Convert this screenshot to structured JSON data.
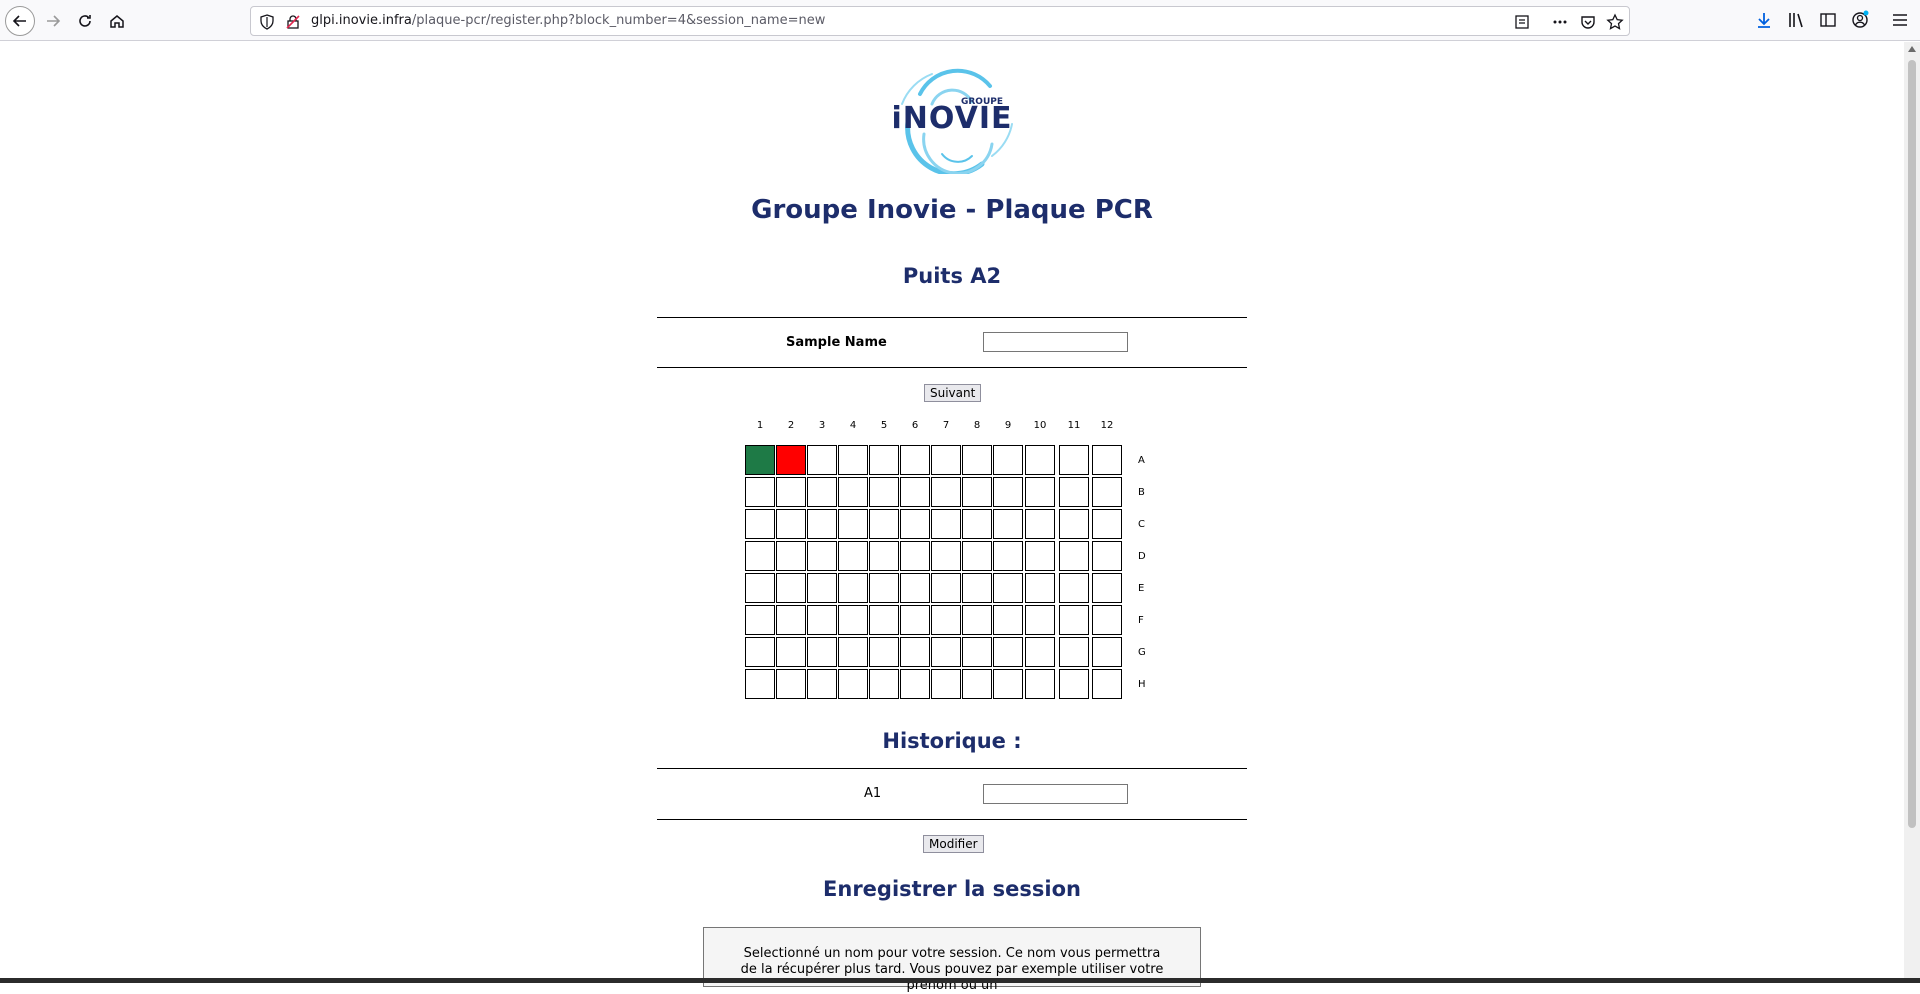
{
  "browser": {
    "url_host": "glpi.inovie.infra",
    "url_path": "/plaque-pcr/register.php?block_number=4&session_name=new"
  },
  "logo": {
    "small_text": "GROUPE",
    "brand": "iNOVIE"
  },
  "page": {
    "title": "Groupe Inovie - Plaque PCR",
    "well_heading": "Puits A2",
    "sample_label": "Sample Name",
    "sample_value": "",
    "next_button": "Suivant",
    "history_heading": "Historique :",
    "history_rows": [
      {
        "well": "A1",
        "value": ""
      }
    ],
    "modify_button": "Modifier",
    "session_heading": "Enregistrer la session",
    "session_text": "Selectionné un nom pour votre session. Ce nom vous permettra de la récupérer plus tard. Vous pouvez par exemple utiliser votre prénom ou un"
  },
  "plate": {
    "columns": [
      "1",
      "2",
      "3",
      "4",
      "5",
      "6",
      "7",
      "8",
      "9",
      "10",
      "11",
      "12"
    ],
    "rows": [
      "A",
      "B",
      "C",
      "D",
      "E",
      "F",
      "G",
      "H"
    ],
    "filled": [
      {
        "row": "A",
        "col": "1",
        "status": "done",
        "color": "#1e7a46"
      },
      {
        "row": "A",
        "col": "2",
        "status": "current",
        "color": "#ff0000"
      }
    ]
  },
  "colors": {
    "heading": "#1d2d6b",
    "done_well": "#1e7a46",
    "current_well": "#ff0000"
  }
}
